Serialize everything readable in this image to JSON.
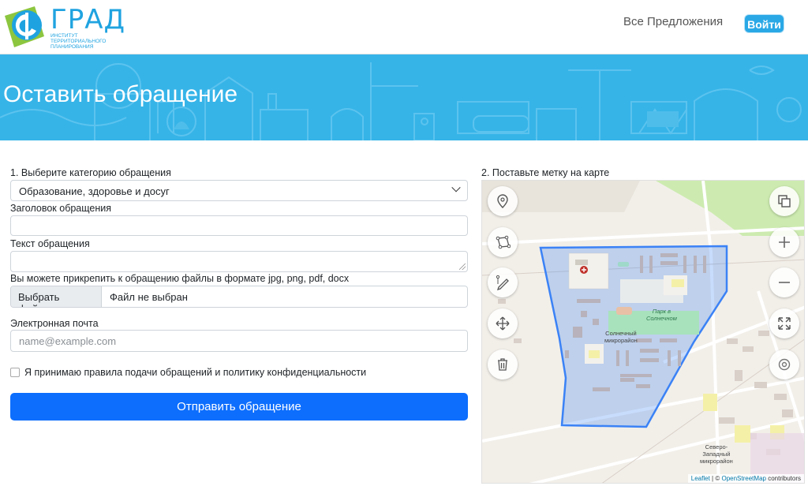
{
  "header": {
    "logo_title": "ГРАД",
    "logo_sub": [
      "ИНСТИТУТ",
      "ТЕРРИТОРИАЛЬНОГО",
      "ПЛАНИРОВАНИЯ"
    ],
    "nav_all": "Все Предложения",
    "login": "Войти"
  },
  "hero": {
    "title": "Оставить обращение"
  },
  "form": {
    "category_label": "1. Выберите категорию обращения",
    "category_value": "Образование, здоровье и досуг",
    "title_label": "Заголовок обращения",
    "text_label": "Текст обращения",
    "attach_label": "Вы можете прикрепить к обращению файлы в формате jpg, png, pdf, docx",
    "file_button": "Выбрать файлы",
    "file_status": "Файл не выбран",
    "email_label": "Электронная почта",
    "email_placeholder": "name@example.com",
    "agree_label": "Я принимаю правила подачи обращений и политику конфиденциальности",
    "submit": "Отправить обращение"
  },
  "map": {
    "label": "2. Поставьте метку на карте",
    "park": [
      "Парк в",
      "Солнечном"
    ],
    "district": [
      "Солнечный",
      "микрорайон"
    ],
    "district2": [
      "Северо-",
      "Западный",
      "микрорайон"
    ],
    "attribution_leaflet": "Leaflet",
    "attribution_sep": "| ©",
    "attribution_osm": "OpenStreetMap",
    "attribution_rest": "contributors",
    "polygon_color": "#3b82f6"
  },
  "colors": {
    "brand": "#1fa3e0",
    "hero": "#36b4e8",
    "primary": "#0d6efd"
  }
}
